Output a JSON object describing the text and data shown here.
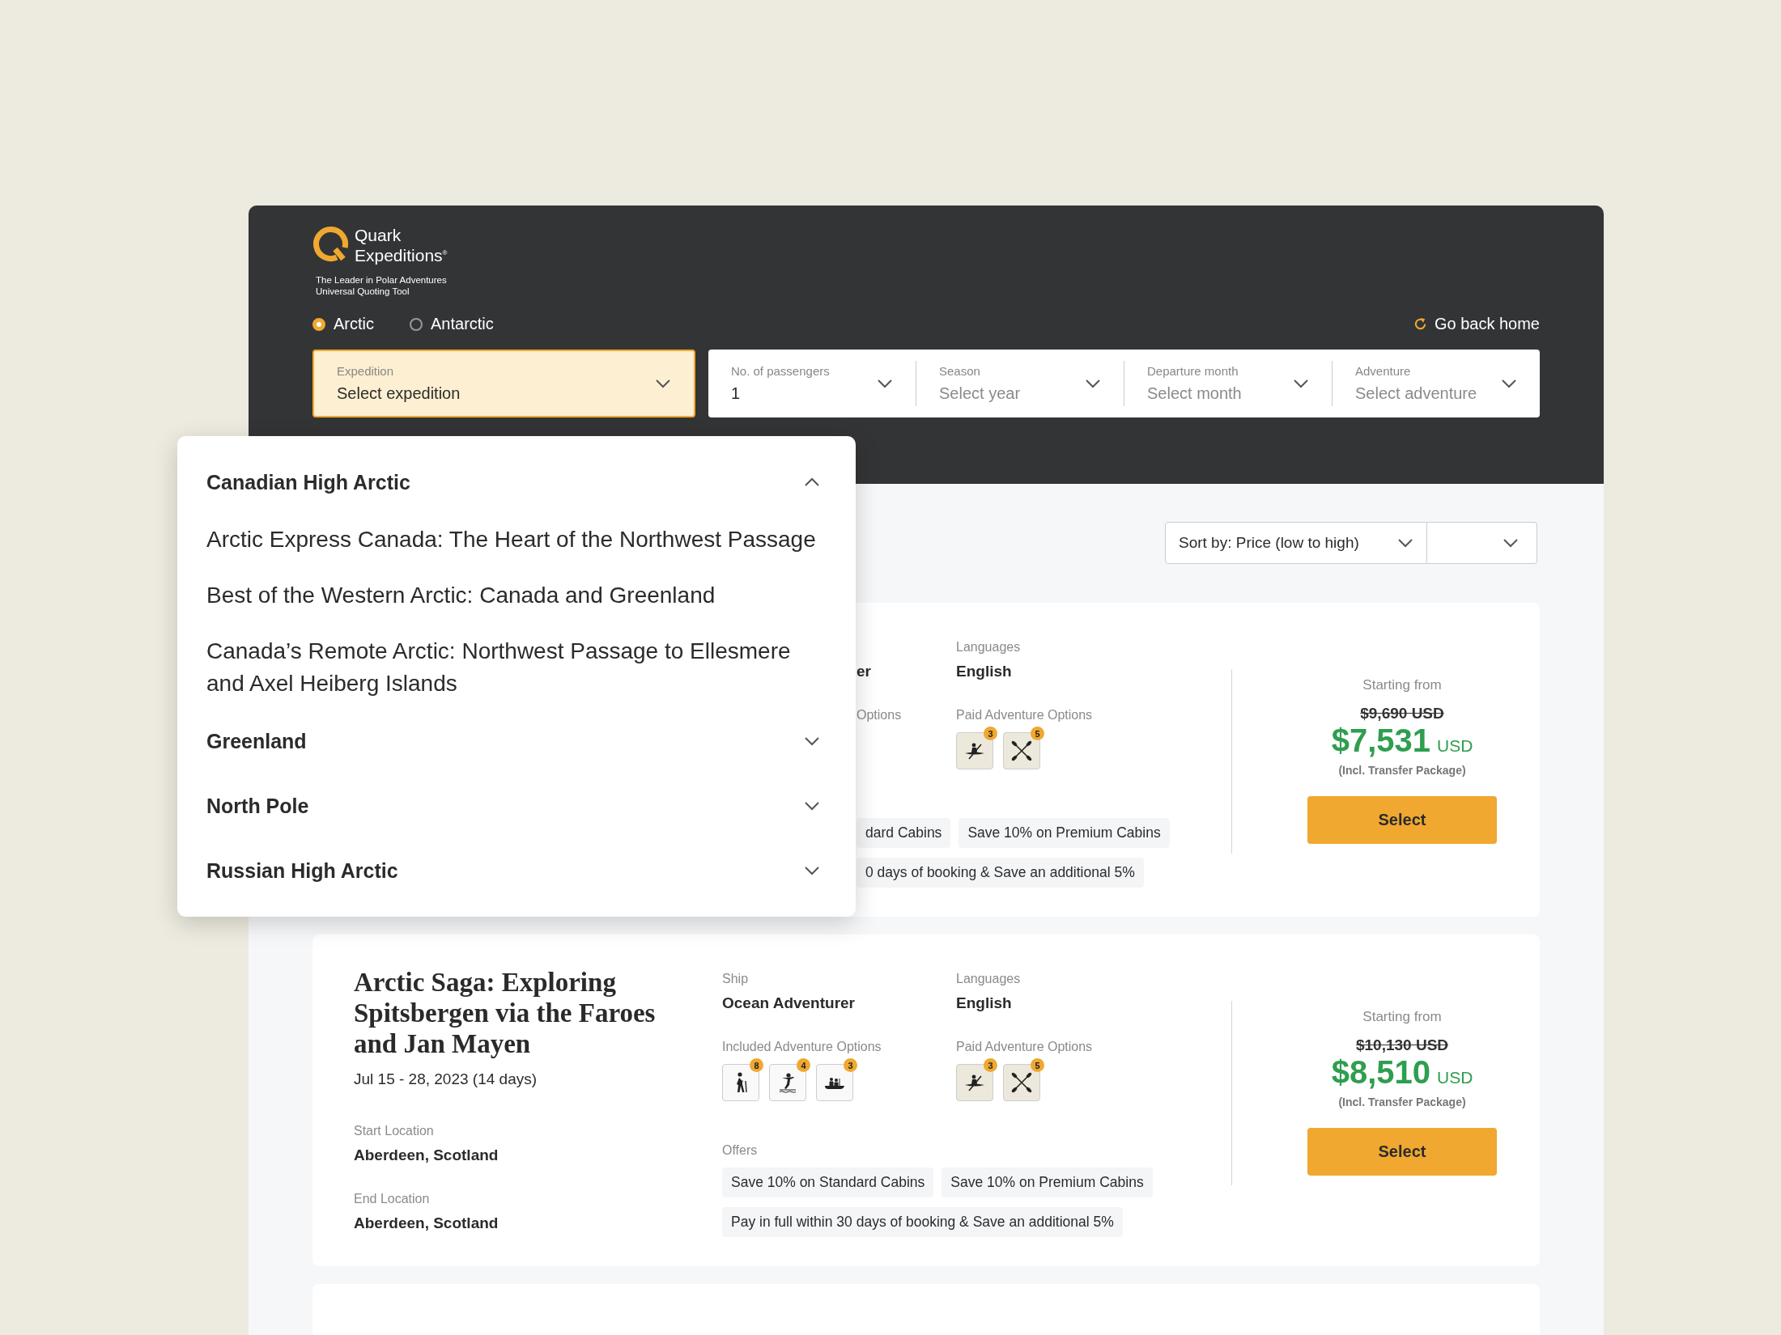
{
  "brand": {
    "name": [
      "Quark",
      "Expeditions$^{®}$"
    ],
    "tagline": [
      "The Leader in Polar Adventures",
      "Universal Quoting Tool"
    ]
  },
  "regions": [
    {
      "label": "Arctic",
      "selected": true
    },
    {
      "label": "Antarctic",
      "selected": false
    }
  ],
  "home_link": "Go back home",
  "expedition_filter": {
    "label": "Expedition",
    "value": "Select expedition",
    "open": true
  },
  "filters": [
    {
      "label": "No. of passengers",
      "value": "1"
    },
    {
      "label": "Season",
      "placeholder": "Select year"
    },
    {
      "label": "Departure month",
      "placeholder": "Select month"
    },
    {
      "label": "Adventure",
      "placeholder": "Select adventure"
    }
  ],
  "sort": {
    "label": "Sort by: Price (low to high)"
  },
  "dropdown": {
    "groups": [
      {
        "name": "Canadian High Arctic",
        "expanded": true,
        "items": [
          "Arctic Express Canada: The Heart of the Northwest Passage",
          "Best of the Western Arctic: Canada and Greenland",
          "Canada’s Remote Arctic: Northwest Passage to Ellesmere and Axel Heiberg Islands"
        ]
      },
      {
        "name": "Greenland",
        "expanded": false
      },
      {
        "name": "North Pole",
        "expanded": false
      },
      {
        "name": "Russian High Arctic",
        "expanded": false
      }
    ]
  },
  "cards": [
    {
      "kind": "partial",
      "ship_value": "er",
      "languages_label": "Languages",
      "languages": "English",
      "included_label": "Options",
      "paid_label": "Paid Adventure Options",
      "paid_options": [
        {
          "kind": "kayak",
          "count": "3"
        },
        {
          "kind": "paddles",
          "count": "5"
        }
      ],
      "offers": [
        "dard Cabins",
        "Save 10% on Premium Cabins",
        "0 days of booking & Save an additional 5%"
      ],
      "price_label": "Starting from",
      "original_price": "$9,690 USD",
      "price": "$7,531",
      "currency": "USD",
      "price_note": "(Incl. Transfer Package)",
      "button": "Select"
    },
    {
      "kind": "full",
      "title": "Arctic Saga: Exploring Spitsbergen via the Faroes and Jan Mayen",
      "dates": "Jul 15 - 28, 2023 (14 days)",
      "start_label": "Start Location",
      "start": "Aberdeen, Scotland",
      "end_label": "End Location",
      "end": "Aberdeen, Scotland",
      "ship_label": "Ship",
      "ship_value": "Ocean Adventurer",
      "languages_label": "Languages",
      "languages": "English",
      "included_label": "Included Adventure Options",
      "included_options": [
        {
          "kind": "hiking",
          "count": "8"
        },
        {
          "kind": "diving",
          "count": "4"
        },
        {
          "kind": "raft",
          "count": "3"
        }
      ],
      "paid_label": "Paid Adventure Options",
      "paid_options": [
        {
          "kind": "kayak",
          "count": "3"
        },
        {
          "kind": "paddles",
          "count": "5"
        }
      ],
      "offers_label": "Offers",
      "offers": [
        "Save 10% on Standard Cabins",
        "Save 10% on Premium Cabins",
        "Pay in full within 30 days of booking & Save an additional 5%"
      ],
      "price_label": "Starting from",
      "original_price": "$10,130 USD",
      "price": "$8,510",
      "currency": "USD",
      "price_note": "(Incl. Transfer Package)",
      "button": "Select"
    }
  ]
}
